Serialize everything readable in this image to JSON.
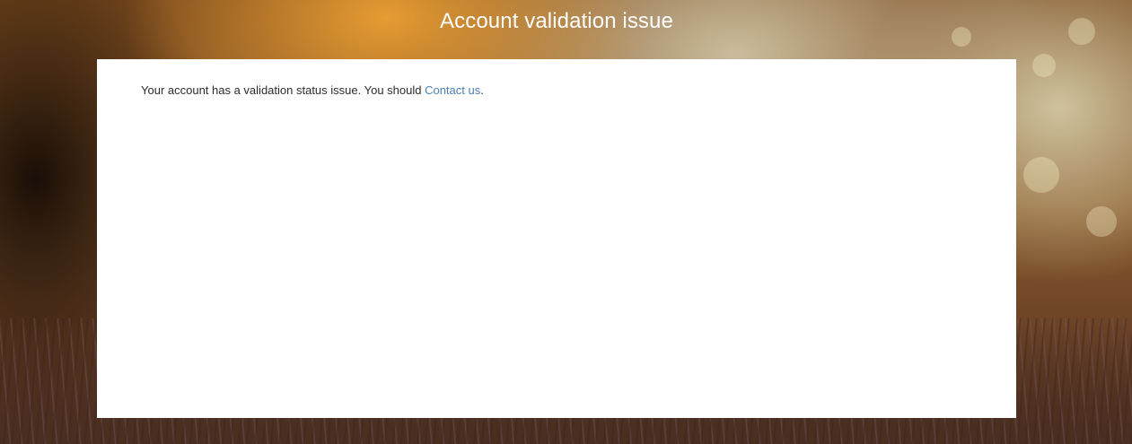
{
  "header": {
    "title": "Account validation issue"
  },
  "card": {
    "message_text": "Your account has a validation status issue. You should ",
    "link_label": "Contact us",
    "message_end": "."
  },
  "colors": {
    "link": "#4b7fb5",
    "card_background": "#ffffff",
    "title_text": "#ffffff"
  }
}
